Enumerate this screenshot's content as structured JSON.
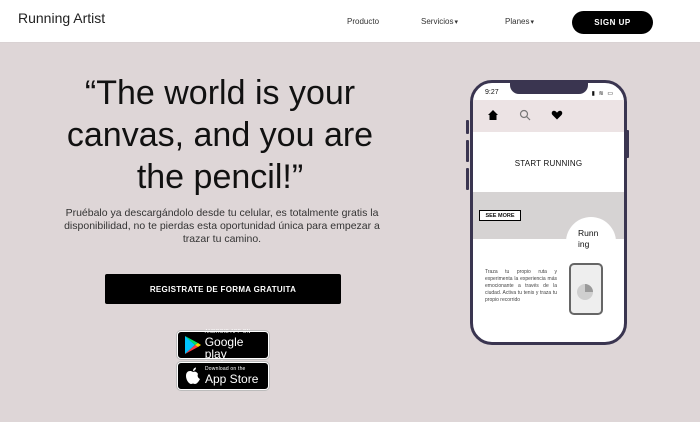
{
  "navbar": {
    "brand": "Running Artist",
    "items": [
      {
        "label": "Producto",
        "has_dropdown": false
      },
      {
        "label": "Servicios",
        "has_dropdown": true
      },
      {
        "label": "Planes",
        "has_dropdown": true
      }
    ],
    "signup_label": "SIGN UP"
  },
  "hero": {
    "title": "“The world is your canvas, and you are the pencil!”",
    "subtitle": "Pruébalo ya descargándolo desde tu celular, es totalmente gratis la disponibilidad, no te pierdas esta oportunidad única para empezar a trazar tu camino.",
    "cta_label": "REGISTRATE DE FORMA GRATUITA"
  },
  "stores": {
    "google_play": {
      "small": "ANDROID APP ON",
      "big": "Google play"
    },
    "app_store": {
      "small": "Download on the",
      "big": "App Store"
    }
  },
  "phone": {
    "time": "9:27",
    "start_label": "START RUNNING",
    "see_more_label": "SEE MORE",
    "running_label_1": "Runn",
    "running_label_2": "ing",
    "description": "Traza tu propio ruta y experimenta la experiencia más emocionante a través de la ciudad. Activa tu tenis y traza tu propio recorrido"
  },
  "colors": {
    "page_bg": "#ded6d7",
    "navbar_bg": "#ffffff",
    "primary": "#000000",
    "phone_frame": "#3a3550"
  },
  "icons": [
    "chevron-down-icon",
    "google-play-icon",
    "apple-icon",
    "home-icon",
    "search-icon",
    "heart-icon"
  ]
}
